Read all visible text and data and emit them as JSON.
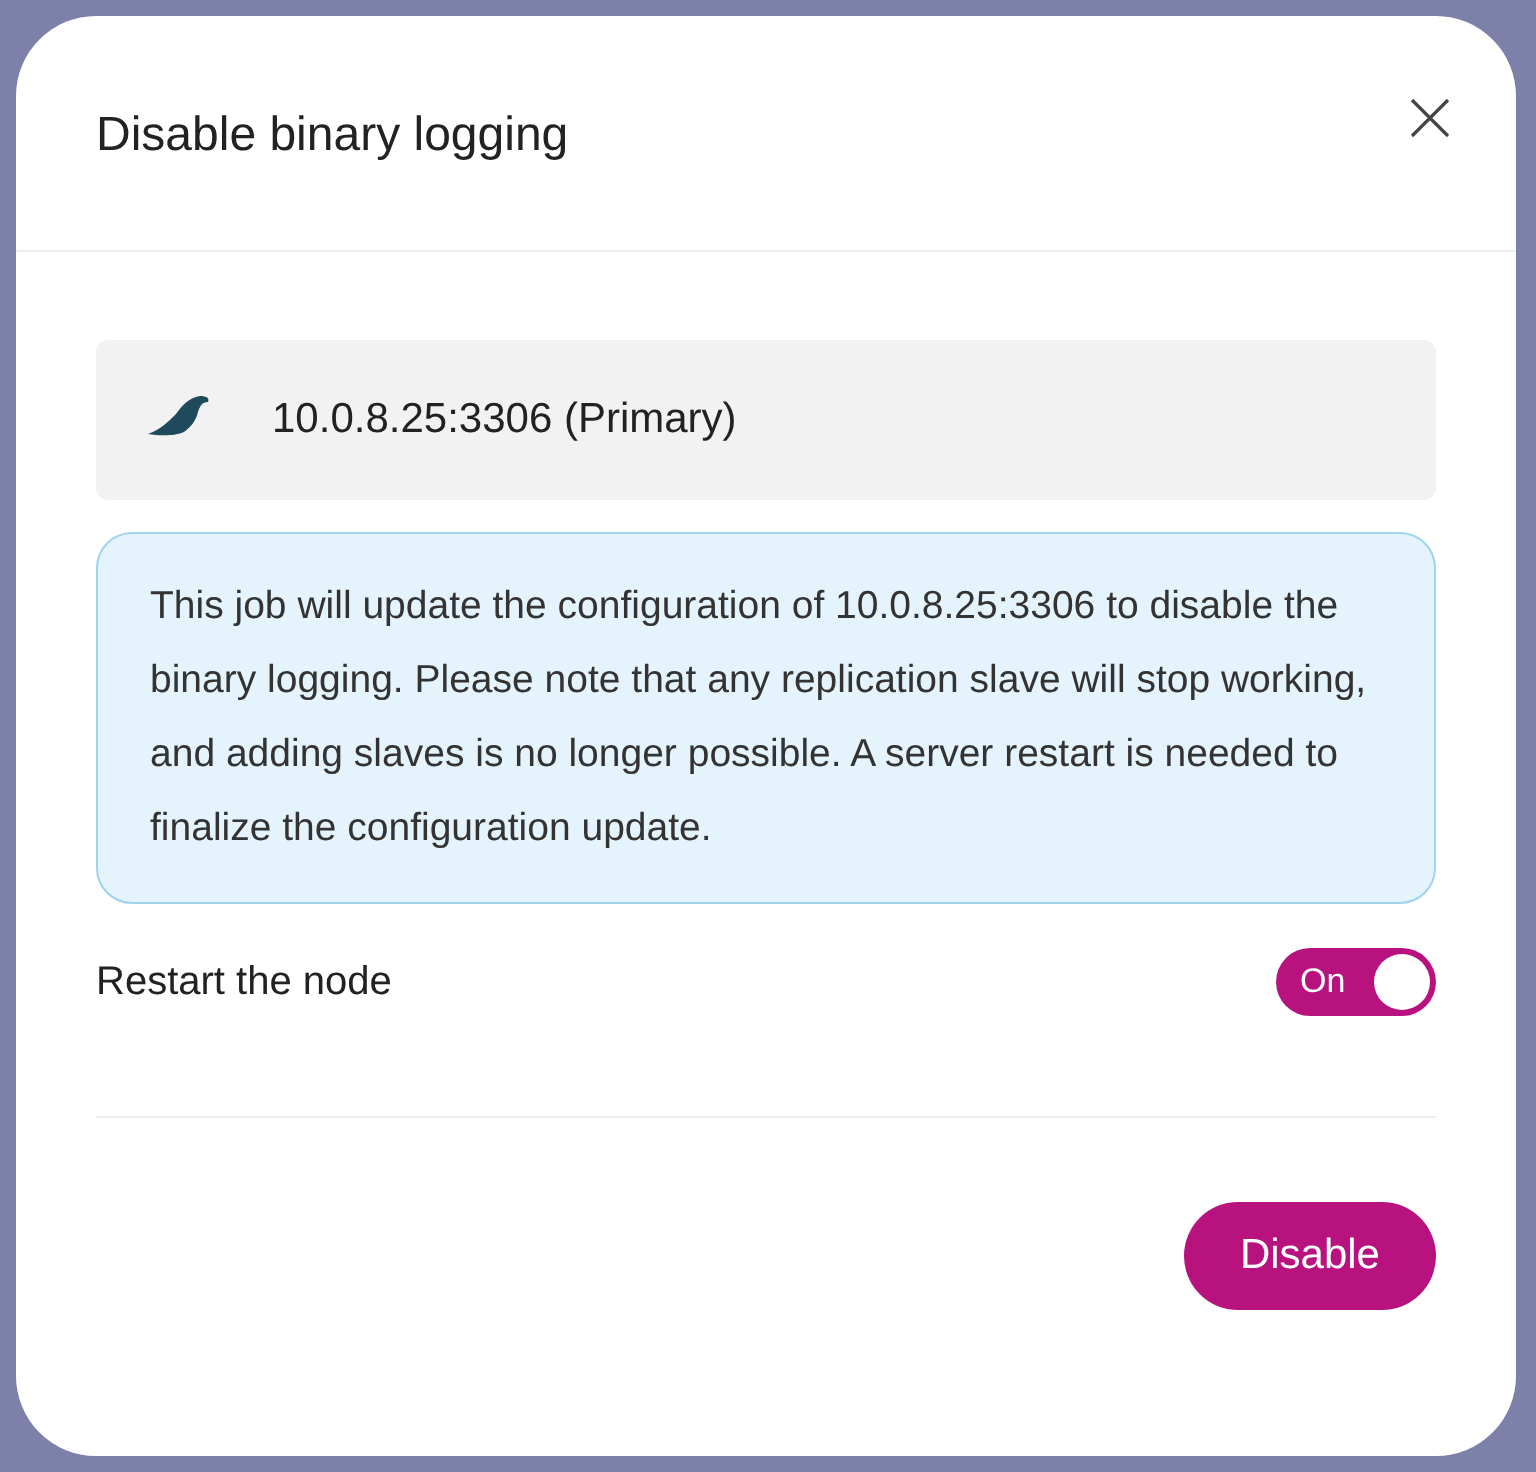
{
  "dialog": {
    "title": "Disable binary logging"
  },
  "node": {
    "address": "10.0.8.25:3306 (Primary)"
  },
  "info": "This job will update the configuration of 10.0.8.25:3306 to disable the binary logging. Please note that any replication slave will stop working, and adding slaves is no longer possible. A server restart is needed to finalize the configuration update.",
  "restart_toggle": {
    "label": "Restart the node",
    "state_text": "On",
    "on": true
  },
  "buttons": [
    {
      "label": "Disable"
    }
  ]
}
